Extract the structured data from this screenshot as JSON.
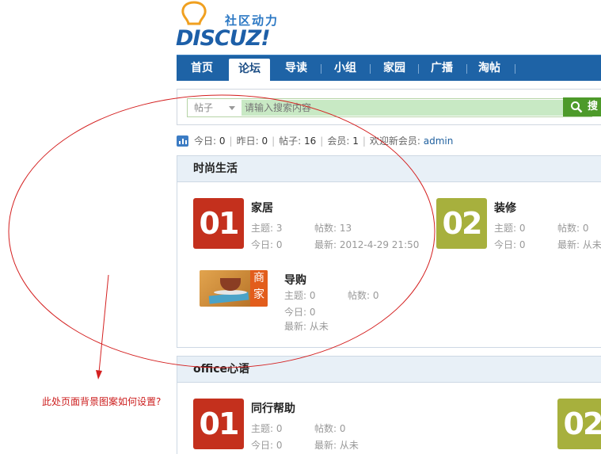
{
  "logo": {
    "slogan": "社区动力",
    "wordmark": "DISCUZ!",
    "icon": "lightbulb-icon"
  },
  "nav": {
    "items": [
      {
        "label": "首页",
        "active": false
      },
      {
        "label": "论坛",
        "active": true
      },
      {
        "label": "导读",
        "active": false
      },
      {
        "label": "小组",
        "active": false
      },
      {
        "label": "家园",
        "active": false
      },
      {
        "label": "广播",
        "active": false
      },
      {
        "label": "淘帖",
        "active": false
      }
    ]
  },
  "search": {
    "type": "帖子",
    "placeholder": "请输入搜索内容",
    "button": "搜",
    "icon": "search-icon"
  },
  "stats": {
    "today_label": "今日:",
    "today": "0",
    "yesterday_label": "昨日:",
    "yesterday": "0",
    "posts_label": "帖子:",
    "posts": "16",
    "members_label": "会员:",
    "members": "1",
    "welcome_label": "欢迎新会员:",
    "newest": "admin",
    "icon": "chart-icon"
  },
  "categories": [
    {
      "title": "时尚生活",
      "forums": [
        {
          "num": "01",
          "name": "家居",
          "threads_label": "主题:",
          "threads": "3",
          "posts_label": "帖数:",
          "posts": "13",
          "today_label": "今日:",
          "today": "0",
          "latest_label": "最新:",
          "latest": "2012-4-29 21:50",
          "color": "#c4301d"
        },
        {
          "num": "02",
          "name": "装修",
          "threads_label": "主题:",
          "threads": "0",
          "posts_label": "帖数:",
          "posts": "0",
          "today_label": "今日:",
          "today": "0",
          "latest_label": "最新:",
          "latest": "从未",
          "color": "#a7b03d"
        },
        {
          "name": "导购",
          "badge": "商家",
          "threads_label": "主题:",
          "threads": "0",
          "posts_label": "帖数:",
          "posts": "0",
          "today_label": "今日:",
          "today": "0",
          "latest_label": "最新:",
          "latest": "从未"
        }
      ]
    },
    {
      "title": "office心语",
      "forums": [
        {
          "num": "01",
          "name": "同行帮助",
          "threads_label": "主题:",
          "threads": "0",
          "posts_label": "帖数:",
          "posts": "0",
          "today_label": "今日:",
          "today": "0",
          "latest_label": "最新:",
          "latest": "从未",
          "color": "#c4301d"
        },
        {
          "num": "02",
          "color": "#a7b03d"
        }
      ]
    }
  ],
  "annotation": {
    "note": "此处页面背景图案如何设置?",
    "color": "#cc1e1e"
  }
}
